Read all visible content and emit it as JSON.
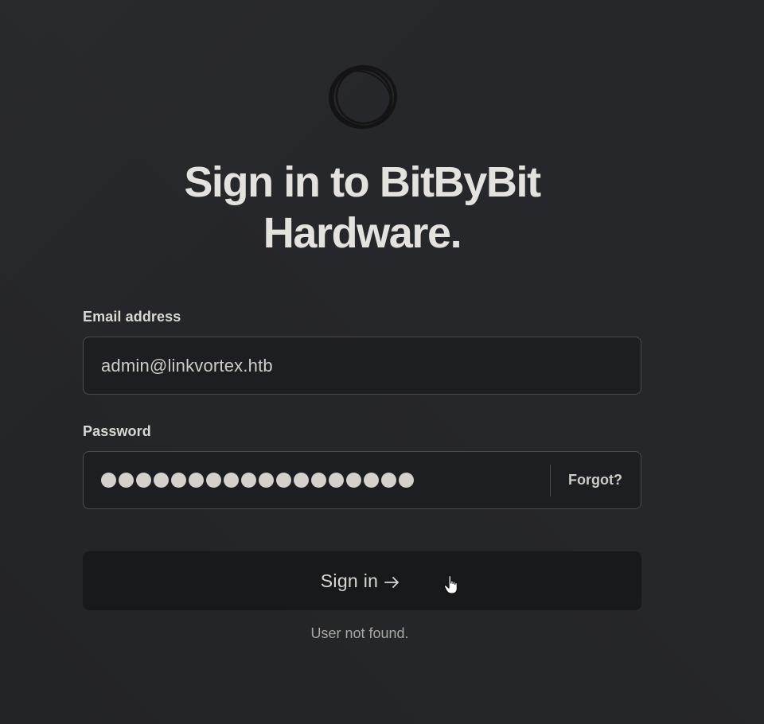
{
  "logo": {
    "icon": "scribble-circle-logo"
  },
  "heading": {
    "line1": "Sign in to BitByBit",
    "line2": "Hardware."
  },
  "form": {
    "email_label": "Email address",
    "email_value": "admin@linkvortex.htb",
    "password_label": "Password",
    "password_mask_count": 18,
    "forgot_label": "Forgot?",
    "submit_label": "Sign in",
    "submit_icon": "arrow-right-icon",
    "error_message": "User not found."
  },
  "colors": {
    "background": "#26272a",
    "input_background": "#1d1e21",
    "button_background": "#18191b",
    "text": "#e4e2de",
    "muted_text": "#a9a7a3"
  }
}
